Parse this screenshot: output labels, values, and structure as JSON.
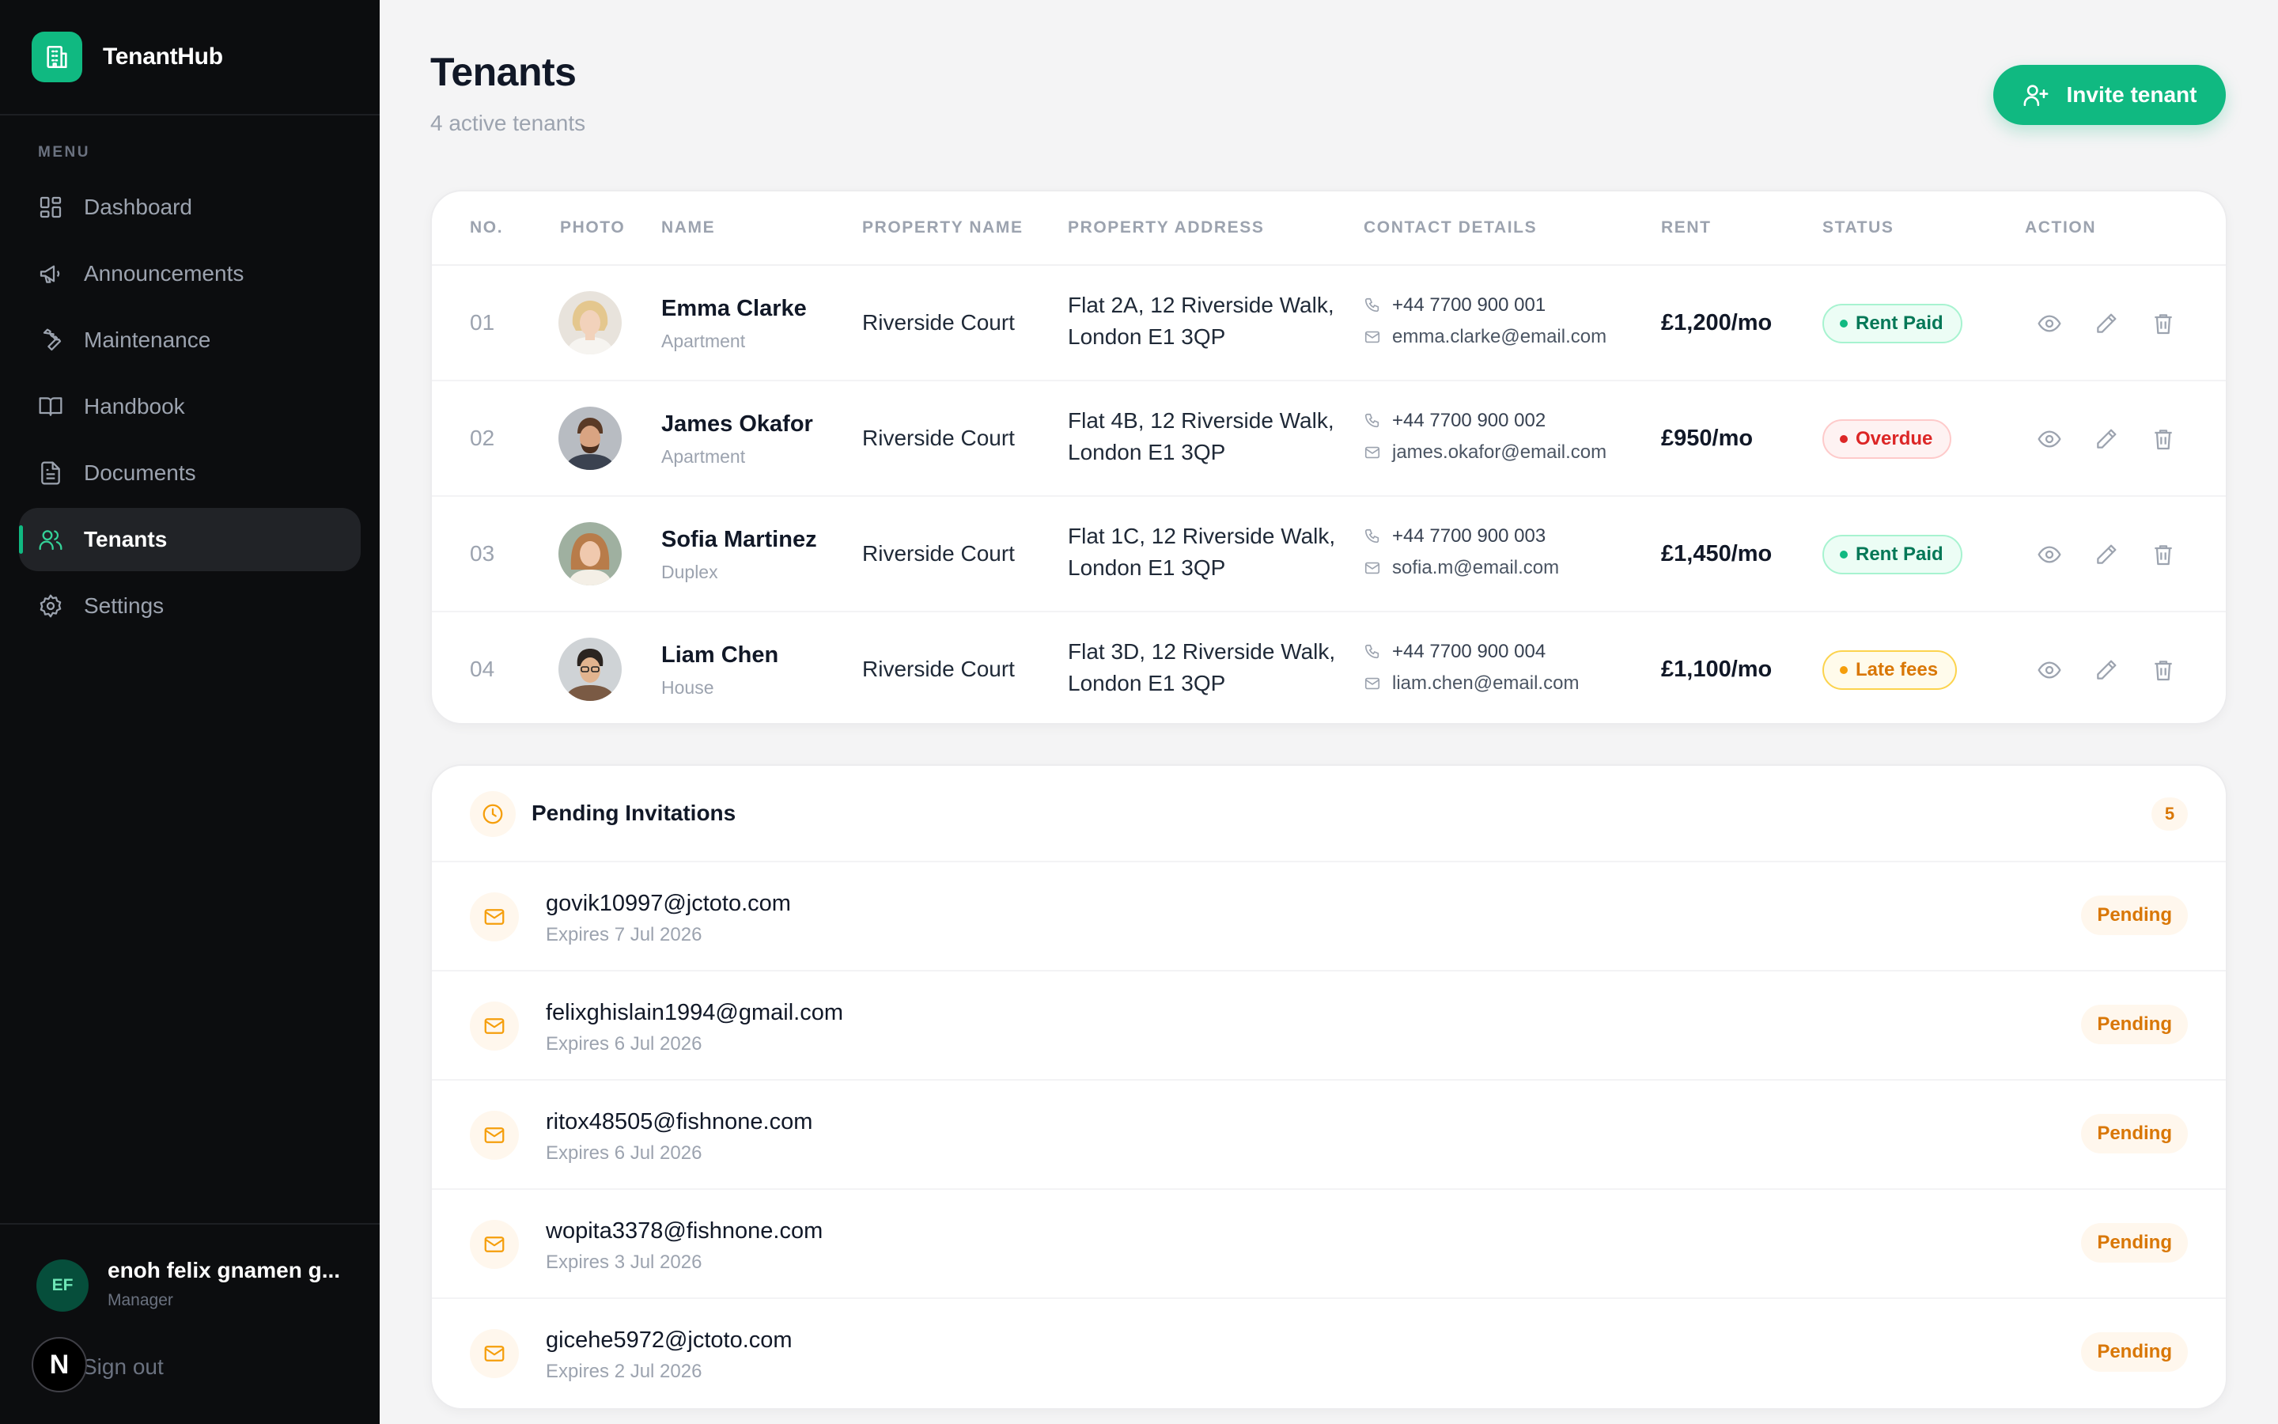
{
  "app": {
    "name": "TenantHub",
    "logo_icon": "building-icon",
    "accent_color": "#10b981"
  },
  "sidebar": {
    "menu_caption": "MENU",
    "items": [
      {
        "label": "Dashboard",
        "icon": "dashboard-icon",
        "active": false
      },
      {
        "label": "Announcements",
        "icon": "megaphone-icon",
        "active": false
      },
      {
        "label": "Maintenance",
        "icon": "wrench-icon",
        "active": false
      },
      {
        "label": "Handbook",
        "icon": "book-icon",
        "active": false
      },
      {
        "label": "Documents",
        "icon": "document-icon",
        "active": false
      },
      {
        "label": "Tenants",
        "icon": "users-icon",
        "active": true
      },
      {
        "label": "Settings",
        "icon": "gear-icon",
        "active": false
      }
    ],
    "user": {
      "initials": "EF",
      "name": "enoh felix gnamen g...",
      "role": "Manager"
    },
    "signout_label": "Sign out",
    "n_badge": "N"
  },
  "header": {
    "title": "Tenants",
    "subtitle": "4 active tenants",
    "invite_label": "Invite tenant"
  },
  "table": {
    "columns": [
      "NO.",
      "PHOTO",
      "NAME",
      "PROPERTY NAME",
      "PROPERTY ADDRESS",
      "CONTACT DETAILS",
      "RENT",
      "STATUS",
      "ACTION"
    ],
    "rows": [
      {
        "no": "01",
        "name": "Emma Clarke",
        "type": "Apartment",
        "property": "Riverside Court",
        "address": "Flat 2A, 12 Riverside Walk, London E1 3QP",
        "phone": "+44 7700 900 001",
        "email": "emma.clarke@email.com",
        "rent": "£1,200/mo",
        "status": "Rent Paid",
        "status_kind": "paid"
      },
      {
        "no": "02",
        "name": "James Okafor",
        "type": "Apartment",
        "property": "Riverside Court",
        "address": "Flat 4B, 12 Riverside Walk, London E1 3QP",
        "phone": "+44 7700 900 002",
        "email": "james.okafor@email.com",
        "rent": "£950/mo",
        "status": "Overdue",
        "status_kind": "overdue"
      },
      {
        "no": "03",
        "name": "Sofia Martinez",
        "type": "Duplex",
        "property": "Riverside Court",
        "address": "Flat 1C, 12 Riverside Walk, London E1 3QP",
        "phone": "+44 7700 900 003",
        "email": "sofia.m@email.com",
        "rent": "£1,450/mo",
        "status": "Rent Paid",
        "status_kind": "paid"
      },
      {
        "no": "04",
        "name": "Liam Chen",
        "type": "House",
        "property": "Riverside Court",
        "address": "Flat 3D, 12 Riverside Walk, London E1 3QP",
        "phone": "+44 7700 900 004",
        "email": "liam.chen@email.com",
        "rent": "£1,100/mo",
        "status": "Late fees",
        "status_kind": "late"
      }
    ],
    "status_colors": {
      "paid": "#047857",
      "overdue": "#dc2626",
      "late": "#d97706"
    }
  },
  "pending": {
    "title": "Pending Invitations",
    "count": "5",
    "items": [
      {
        "email": "govik10997@jctoto.com",
        "expires": "Expires 7 Jul 2026",
        "status": "Pending"
      },
      {
        "email": "felixghislain1994@gmail.com",
        "expires": "Expires 6 Jul 2026",
        "status": "Pending"
      },
      {
        "email": "ritox48505@fishnone.com",
        "expires": "Expires 6 Jul 2026",
        "status": "Pending"
      },
      {
        "email": "wopita3378@fishnone.com",
        "expires": "Expires 3 Jul 2026",
        "status": "Pending"
      },
      {
        "email": "gicehe5972@jctoto.com",
        "expires": "Expires 2 Jul 2026",
        "status": "Pending"
      }
    ]
  }
}
